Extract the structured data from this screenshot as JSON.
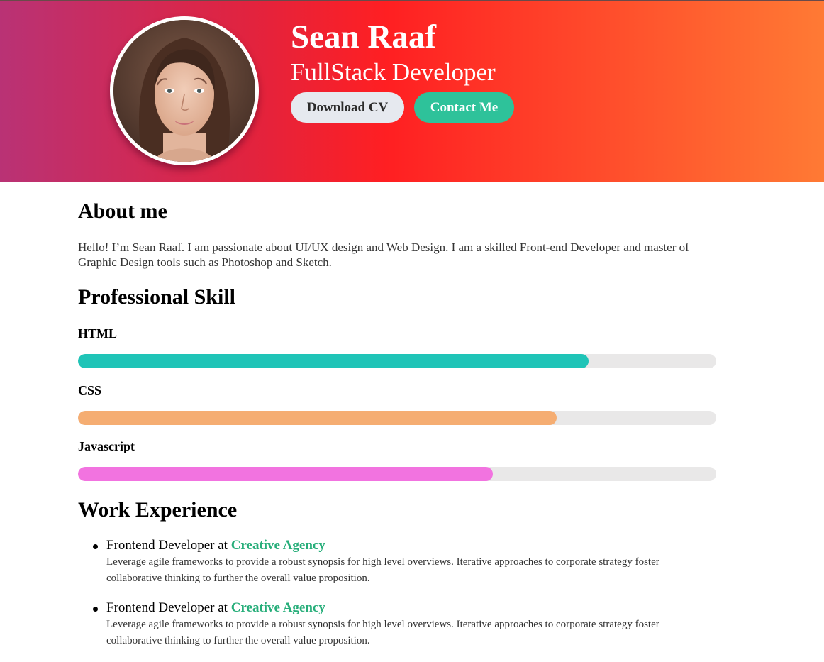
{
  "colors": {
    "header_gradient": [
      "#b93275",
      "#ff1f22",
      "#ff7a34"
    ],
    "contact_button": "#2ec29a",
    "download_button": "#e6e9ef",
    "company_link": "#27ae7a",
    "bar_track": "#e9e8e8"
  },
  "header": {
    "name": "Sean Raaf",
    "role": "FullStack Developer",
    "download_cv_label": "Download CV",
    "contact_label": "Contact Me"
  },
  "about": {
    "heading": "About me",
    "text": "Hello! I’m Sean Raaf. I am passionate about UI/UX design and Web Design. I am a skilled Front-end Developer and master of Graphic Design tools such as Photoshop and Sketch."
  },
  "skills": {
    "heading": "Professional Skill",
    "items": [
      {
        "label": "HTML",
        "percent": 80,
        "color": "#1fc4b7"
      },
      {
        "label": "CSS",
        "percent": 75,
        "color": "#f5ad72"
      },
      {
        "label": "Javascript",
        "percent": 65,
        "color": "#f273e0"
      }
    ]
  },
  "experience": {
    "heading": "Work Experience",
    "items": [
      {
        "role": "Frontend Developer",
        "connector": "at",
        "company": "Creative Agency",
        "description": "Leverage agile frameworks to provide a robust synopsis for high level overviews. Iterative approaches to corporate strategy foster collaborative thinking to further the overall value proposition."
      },
      {
        "role": "Frontend Developer",
        "connector": "at",
        "company": "Creative Agency",
        "description": "Leverage agile frameworks to provide a robust synopsis for high level overviews. Iterative approaches to corporate strategy foster collaborative thinking to further the overall value proposition."
      }
    ]
  }
}
